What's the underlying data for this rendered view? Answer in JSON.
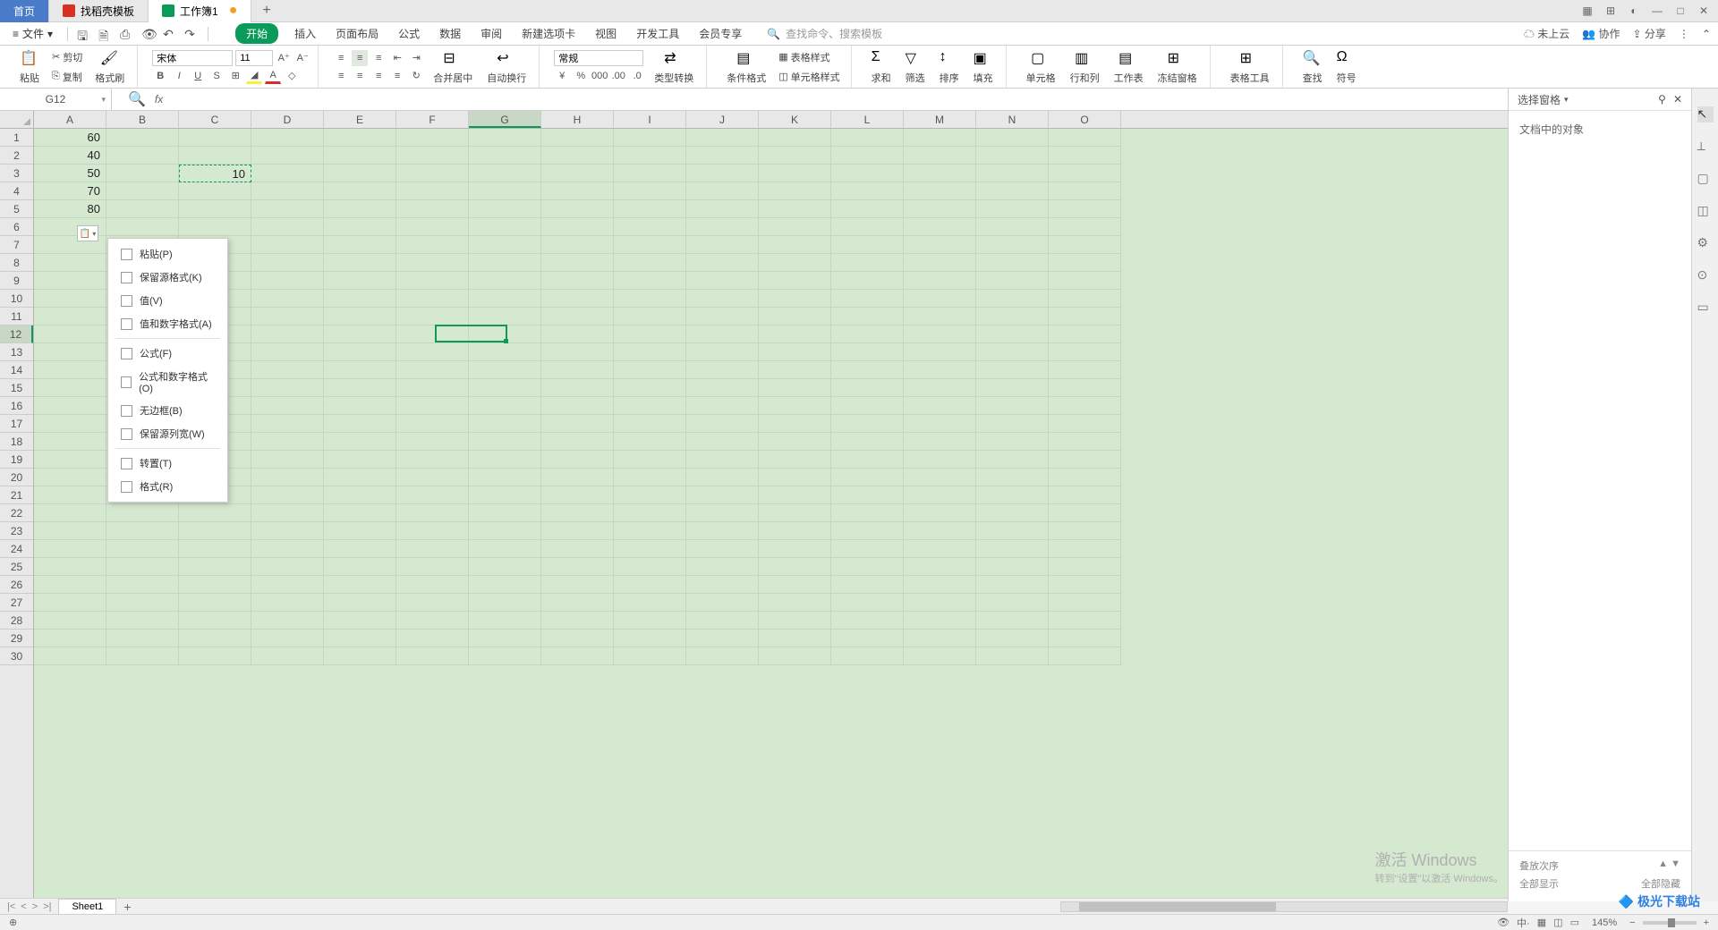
{
  "titleBar": {
    "homeTab": "首页",
    "tabs": [
      {
        "icon": "red",
        "label": "找稻壳模板"
      },
      {
        "icon": "green",
        "label": "工作簿1",
        "modified": true,
        "active": true
      }
    ]
  },
  "menuBar": {
    "fileMenu": "文件",
    "ribbonTabs": [
      "开始",
      "插入",
      "页面布局",
      "公式",
      "数据",
      "审阅",
      "新建选项卡",
      "视图",
      "开发工具",
      "会员专享"
    ],
    "activeTab": 0,
    "searchPlaceholder": "查找命令、搜索模板",
    "cloudStatus": "未上云",
    "collab": "协作",
    "share": "分享"
  },
  "ribbon": {
    "paste": "粘贴",
    "cut": "剪切",
    "copy": "复制",
    "formatPainter": "格式刷",
    "fontName": "宋体",
    "fontSize": "11",
    "mergeCenter": "合并居中",
    "autoWrap": "自动换行",
    "numberFormat": "常规",
    "typeConvert": "类型转换",
    "condFormat": "条件格式",
    "tableStyle": "表格样式",
    "cellStyle": "单元格样式",
    "sum": "求和",
    "filter": "筛选",
    "sort": "排序",
    "fill": "填充",
    "cell": "单元格",
    "rowCol": "行和列",
    "sheet": "工作表",
    "freeze": "冻结窗格",
    "tableTools": "表格工具",
    "find": "查找",
    "symbol": "符号"
  },
  "nameBox": "G12",
  "fxLabel": "fx",
  "columns": [
    "A",
    "B",
    "C",
    "D",
    "E",
    "F",
    "G",
    "H",
    "I",
    "J",
    "K",
    "L",
    "M",
    "N",
    "O"
  ],
  "selectedCol": 6,
  "selectedRow": 12,
  "rowCount": 30,
  "cellData": {
    "A1": "60",
    "A2": "40",
    "A3": "50",
    "A4": "70",
    "A5": "80",
    "C3": "10"
  },
  "copiedCell": "C3",
  "activeCell": {
    "col": 6,
    "row": 12
  },
  "pasteMenu": {
    "items1": [
      "粘贴(P)",
      "保留源格式(K)",
      "值(V)",
      "值和数字格式(A)"
    ],
    "items2": [
      "公式(F)",
      "公式和数字格式(O)",
      "无边框(B)",
      "保留源列宽(W)"
    ],
    "items3": [
      "转置(T)",
      "格式(R)"
    ]
  },
  "rightPanel": {
    "title": "选择窗格",
    "bodyLabel": "文档中的对象",
    "stackOrder": "叠放次序",
    "showAll": "全部显示",
    "hideAll": "全部隐藏"
  },
  "sheetTabs": {
    "sheets": [
      "Sheet1"
    ]
  },
  "statusBar": {
    "zoom": "145%"
  },
  "watermark": {
    "title": "激活 Windows",
    "sub": "转到\"设置\"以激活 Windows。"
  },
  "logo": "极光下载站"
}
